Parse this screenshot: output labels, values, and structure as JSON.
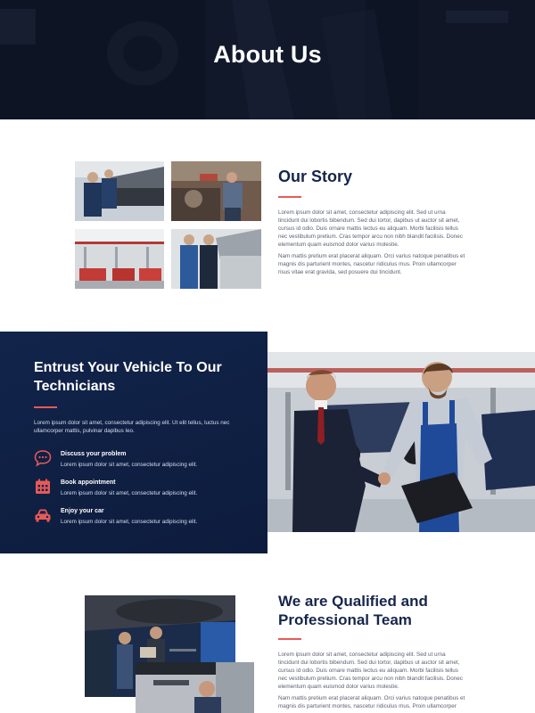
{
  "hero": {
    "title": "About Us"
  },
  "story": {
    "title": "Our Story",
    "p1": "Lorem ipsum dolor sit amet, consectetur adipiscing elit. Sed ut urna tincidunt dui lobortis bibendum. Sed dui tortor, dapibus ut auctor sit amet, cursus id odio. Duis ornare mattis lectus eu aliquam. Morbi facilisis tellus nec vestibulum pretium. Cras tempor arcu non nibh blandit facilisis. Donec elementum quam euismod dolor varius molestie.",
    "p2": "Nam mattis pretium erat placerat aliquam. Orci varius natoque penatibus et magnis dis parturient montes, nascetur ridiculus mus. Proin ullamcorper risus vitae erat gravida, sed posuere dui tincidunt."
  },
  "technicians": {
    "title": "Entrust Your Vehicle To Our Technicians",
    "intro": "Lorem ipsum dolor sit amet, consectetur adipiscing elit. Ut elit tellus, luctus nec ullamcorper mattis, pulvinar dapibus leo.",
    "features": [
      {
        "icon": "chat-bubble-icon",
        "title": "Discuss your problem",
        "desc": "Lorem ipsum dolor sit amet, consectetur adipiscing elit."
      },
      {
        "icon": "calendar-icon",
        "title": "Book appointment",
        "desc": "Lorem ipsum dolor sit amet, consectetur adipiscing elit."
      },
      {
        "icon": "car-icon",
        "title": "Enjoy your car",
        "desc": "Lorem ipsum dolor sit amet, consectetur adipiscing elit."
      }
    ]
  },
  "team": {
    "title": "We are Qualified and Professional Team",
    "p1": "Lorem ipsum dolor sit amet, consectetur adipiscing elit. Sed ut urna tincidunt dui lobortis bibendum. Sed dui tortor, dapibus ut auctor sit amet, cursus id odio. Duis ornare mattis lectus eu aliquam. Morbi facilisis tellus nec vestibulum pretium. Cras tempor arcu non nibh blandit facilisis. Donec elementum quam euismod dolor varius molestie.",
    "p2": "Nam mattis pretium erat placerat aliquam. Orci varius natoque penatibus et magnis dis parturient montes, nascetur ridiculus mus. Proin ullamcorper"
  },
  "colors": {
    "navy": "#12244b",
    "accent": "#e85a56",
    "heading": "#16264a",
    "body_text": "#5b6170"
  }
}
